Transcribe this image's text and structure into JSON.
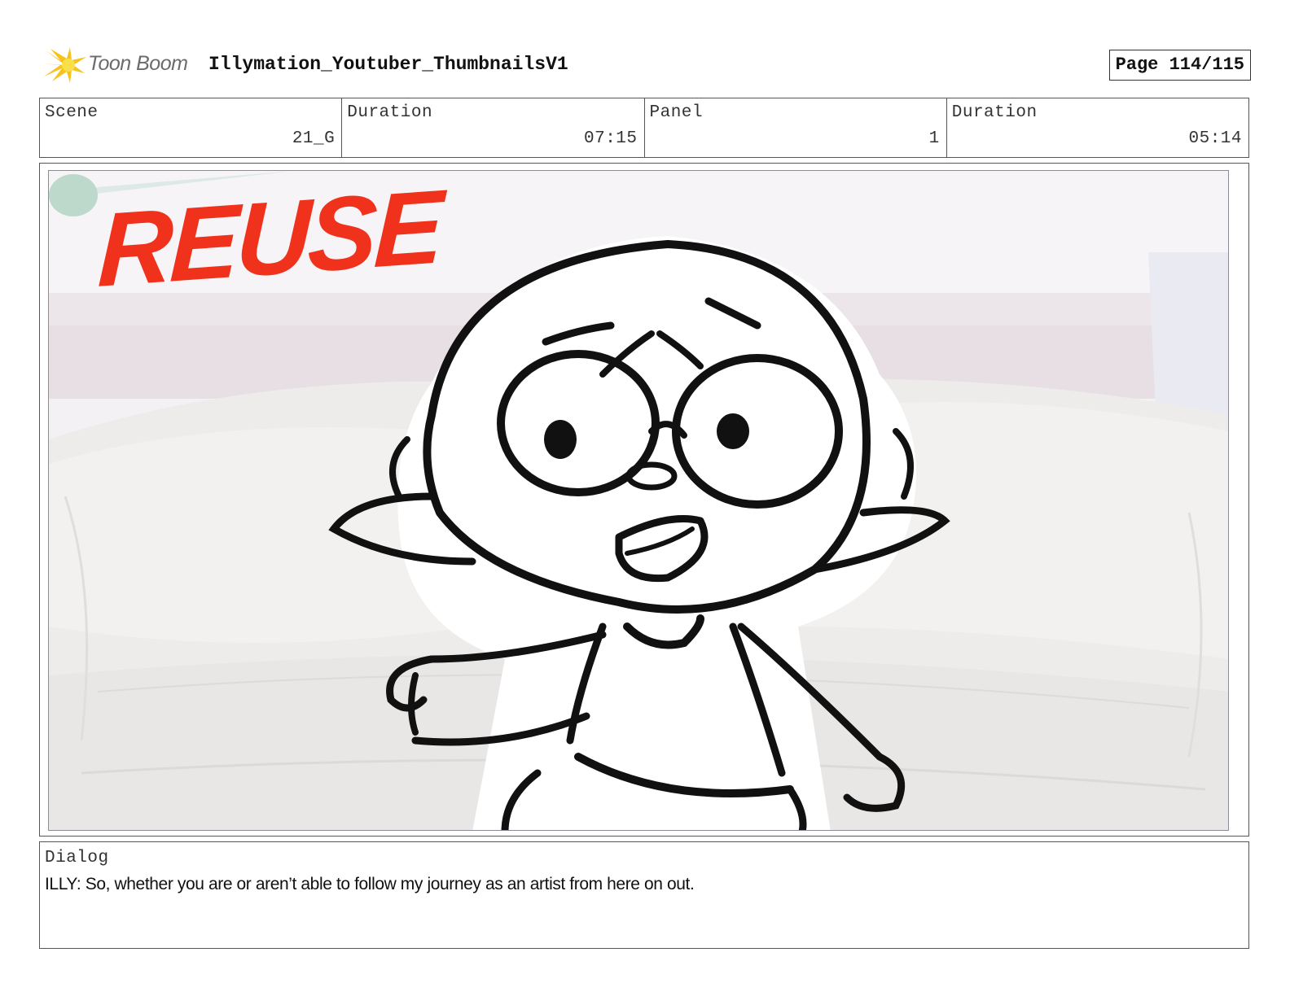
{
  "header": {
    "logo_text": "Toon Boom",
    "project_title": "Illymation_Youtuber_ThumbnailsV1",
    "page_indicator": "Page 114/115"
  },
  "info": {
    "scene_label": "Scene",
    "scene_value": "21_G",
    "scene_duration_label": "Duration",
    "scene_duration_value": "07:15",
    "panel_label": "Panel",
    "panel_value": "1",
    "panel_duration_label": "Duration",
    "panel_duration_value": "05:14"
  },
  "panel": {
    "overlay_text": "REUSE",
    "overlay_color": "#f0321c"
  },
  "dialog": {
    "label": "Dialog",
    "text": "ILLY: So, whether you are or aren’t able to follow my journey as an artist from here on out."
  }
}
